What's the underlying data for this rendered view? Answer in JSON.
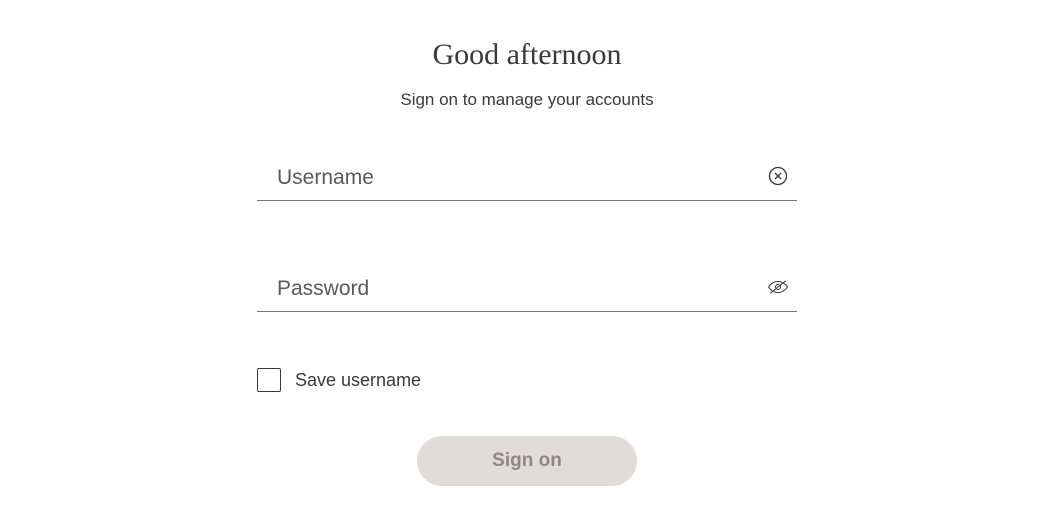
{
  "header": {
    "greeting": "Good afternoon",
    "subtitle": "Sign on to manage your accounts"
  },
  "form": {
    "username": {
      "placeholder": "Username",
      "value": ""
    },
    "password": {
      "placeholder": "Password",
      "value": ""
    },
    "save_username_label": "Save username",
    "submit_label": "Sign on"
  }
}
